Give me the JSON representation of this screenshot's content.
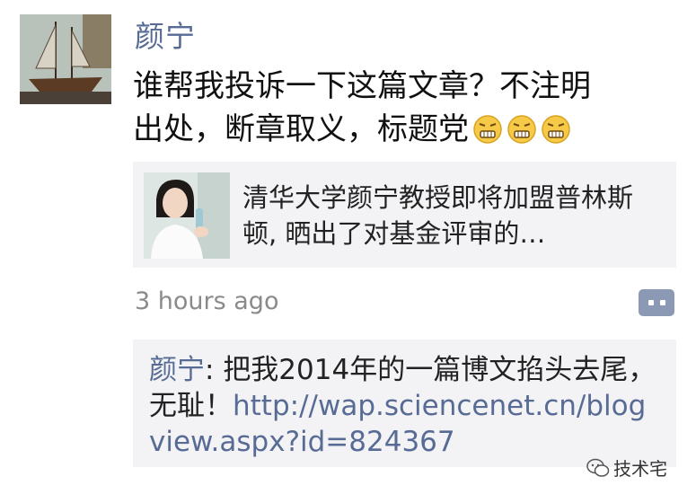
{
  "post": {
    "author": "颜宁",
    "text_line1": "谁帮我投诉一下这篇文章？不注明",
    "text_line2": "出处，断章取义，标题党",
    "emoji_name": "grimace-emoji",
    "shared_article": {
      "title": "清华大学颜宁教授即将加盟普林斯顿, 晒出了对基金评审的…"
    },
    "timestamp": "3 hours ago"
  },
  "comment": {
    "author": "颜宁",
    "separator": ": ",
    "text": "把我2014年的一篇博文掐头去尾，无耻！",
    "link": "http://wap.sciencenet.cn/blogview.aspx?id=824367"
  },
  "watermark": {
    "label": "技术宅",
    "icon": "wechat-icon"
  },
  "colors": {
    "link": "#576b95",
    "card_bg": "#f3f3f5",
    "comment_button": "#8b99b4"
  }
}
